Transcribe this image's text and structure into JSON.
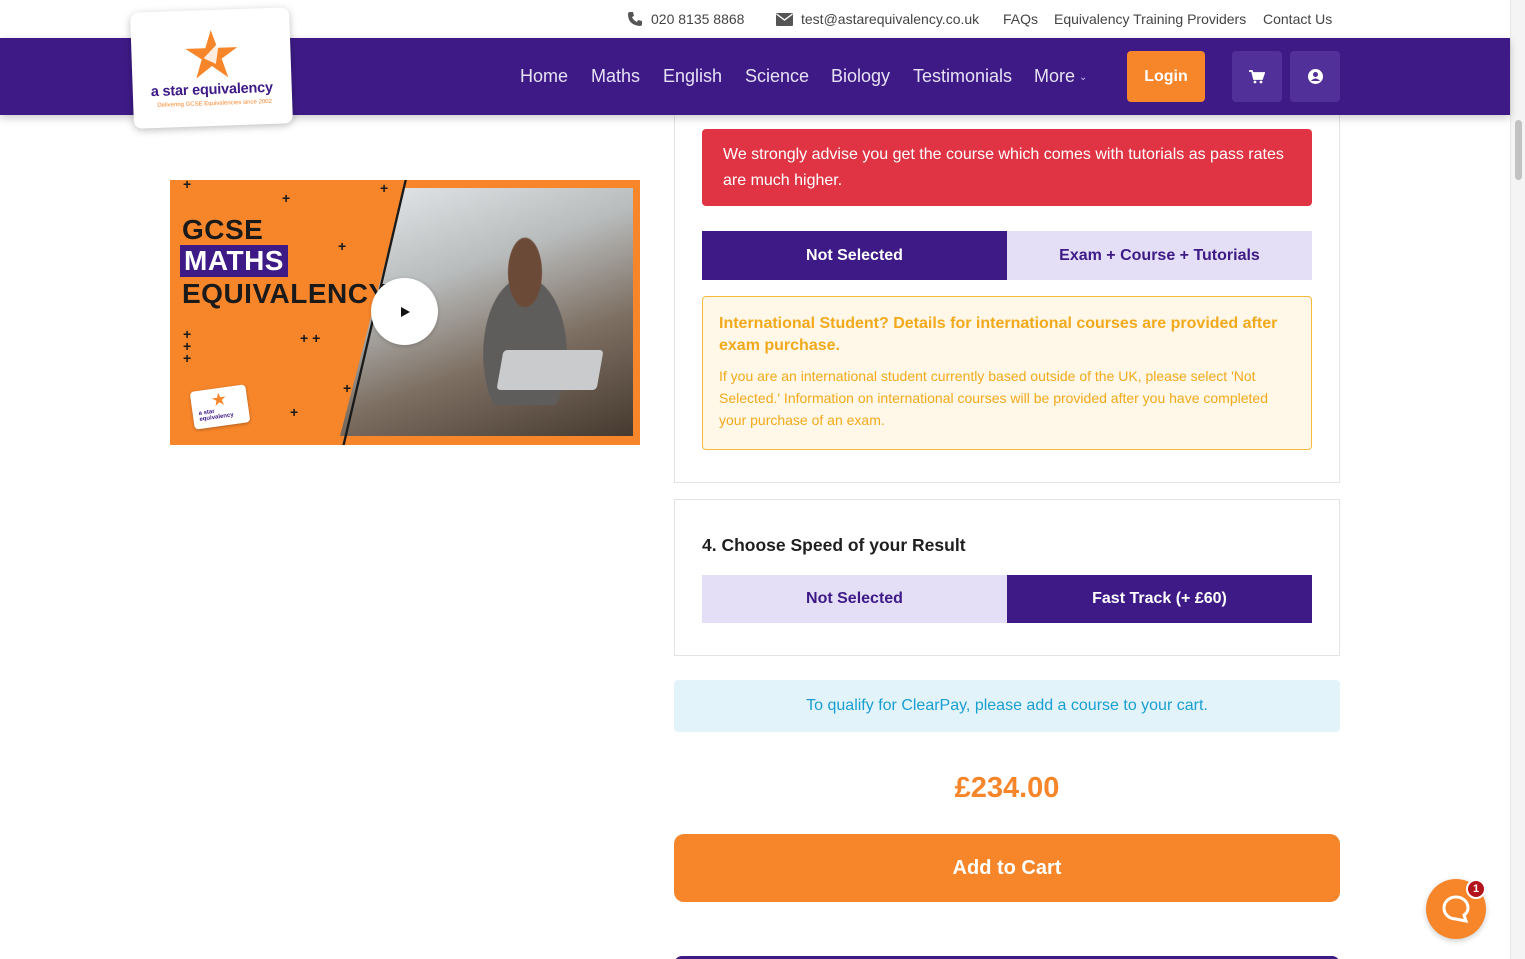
{
  "topbar": {
    "phone": "020 8135 8868",
    "email": "test@astarequivalency.co.uk",
    "links": [
      "FAQs",
      "Equivalency Training Providers",
      "Contact Us"
    ]
  },
  "logo": {
    "brand": "a star equivalency",
    "tagline": "Delivering GCSE Equivalencies since 2002"
  },
  "nav": {
    "items": [
      "Home",
      "Maths",
      "English",
      "Science",
      "Biology",
      "Testimonials"
    ],
    "more_label": "More",
    "login_label": "Login"
  },
  "video": {
    "line1": "GCSE",
    "line2": "MATHS",
    "line3": "EQUIVALENCY",
    "mini_logo_text": "a star equivalency"
  },
  "tutorials": {
    "advice": "We strongly advise you get the course which comes with tutorials as pass rates are much higher.",
    "options": [
      "Not Selected",
      "Exam + Course + Tutorials"
    ],
    "selected_index": 0
  },
  "international": {
    "heading": "International Student? Details for international courses are provided after exam purchase.",
    "body": "If you are an international student currently based outside of the UK, please select 'Not Selected.' Information on international courses will be provided after you have completed your purchase of an exam."
  },
  "speed": {
    "title": "4. Choose Speed of your Result",
    "options": [
      "Not Selected",
      "Fast Track (+ £60)"
    ],
    "selected_index": 1
  },
  "clearpay_note": "To qualify for ClearPay, please add a course to your cart.",
  "price": "£234.00",
  "add_to_cart_label": "Add to Cart",
  "chat": {
    "badge_count": "1"
  },
  "colors": {
    "brand_purple": "#3d1a86",
    "brand_orange": "#f7862b",
    "alert_red": "#e03444",
    "light_purple": "#e4def7"
  }
}
